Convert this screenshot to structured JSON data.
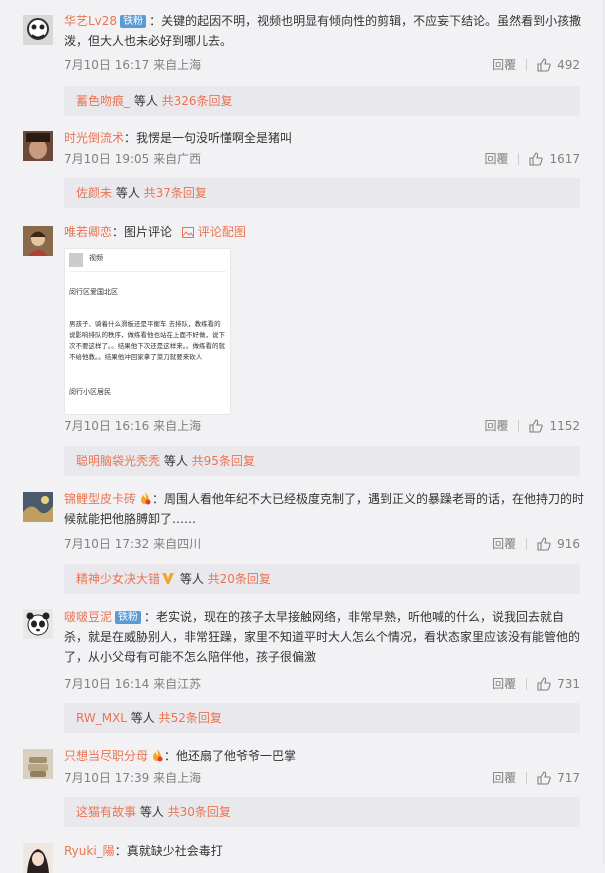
{
  "comments": [
    {
      "username": "华艺Lv28",
      "badge": "铁粉",
      "text": "：关键的起因不明，视频也明显有倾向性的剪辑，不应妄下结论。虽然看到小孩撒泼，但大人也未必好到哪儿去。",
      "time": "7月10日 16:17 来自上海",
      "reply_label": "回覆",
      "likes": "492",
      "reply_summary": {
        "name": "蓄色吻痕_",
        "mid": " 等人 ",
        "count": "共326条回复"
      }
    },
    {
      "username": "时光倒流术",
      "text": "：我愣是一句没听懂啊全是猪叫",
      "time": "7月10日 19:05 来自广西",
      "reply_label": "回覆",
      "likes": "1617",
      "reply_summary": {
        "name": "佐颜未",
        "mid": " 等人 ",
        "count": "共37条回复"
      }
    },
    {
      "username": "唯若卿恋",
      "text": "：图片评论",
      "pic_link": "评论配图",
      "image_text": {
        "header_name": "视频",
        "loc1": "闵行区爱国北区",
        "body": "男孩子、骑着什么滑板还是平衡车 去排队，教练看的说影响排队的秩序，做练看他也站在上面不好做，说下次不要这样了。。结果他下次还是这样来。。做练看的就不给他教。。结果他冲回家拿了菜刀就要来砍人",
        "loc2": "闵行小区居民"
      },
      "time": "7月10日 16:16 来自上海",
      "reply_label": "回覆",
      "likes": "1152",
      "reply_summary": {
        "name": "聪明脑袋光秃秃",
        "mid": " 等人 ",
        "count": "共95条回复"
      }
    },
    {
      "username": "锦鲤型皮卡砖",
      "text": "：周围人看他年纪不大已经极度克制了，遇到正义的暴躁老哥的话，在他持刀的时候就能把他胳膊卸了……",
      "time": "7月10日 17:32 来自四川",
      "reply_label": "回覆",
      "likes": "916",
      "reply_summary": {
        "name": "精神少女决大错",
        "mid": " 等人 ",
        "count": "共20条回复"
      }
    },
    {
      "username": "啵啵豆泥",
      "badge": "铁粉",
      "text": "：老实说，现在的孩子太早接触网络，非常早熟，听他喊的什么，说我回去就自杀，就是在威胁别人，非常狂躁，家里不知道平时大人怎么个情况，看状态家里应该没有能管他的了，从小父母有可能不怎么陪伴他，孩子很偏激",
      "time": "7月10日 16:14 来自江苏",
      "reply_label": "回覆",
      "likes": "731",
      "reply_summary": {
        "name": "RW_MXL",
        "mid": " 等人 ",
        "count": "共52条回复"
      }
    },
    {
      "username": "只想当尽职分母",
      "text": "：他还扇了他爷爷一巴掌",
      "time": "7月10日 17:39 来自上海",
      "reply_label": "回覆",
      "likes": "717",
      "reply_summary": {
        "name": "这猫有故事",
        "mid": " 等人 ",
        "count": "共30条回复"
      }
    },
    {
      "username": "Ryuki_陽",
      "text": "：真就缺少社会毒打"
    }
  ],
  "colors": {
    "accent": "#eb7350",
    "badge": "#5b9bd5",
    "meta": "#808080"
  }
}
